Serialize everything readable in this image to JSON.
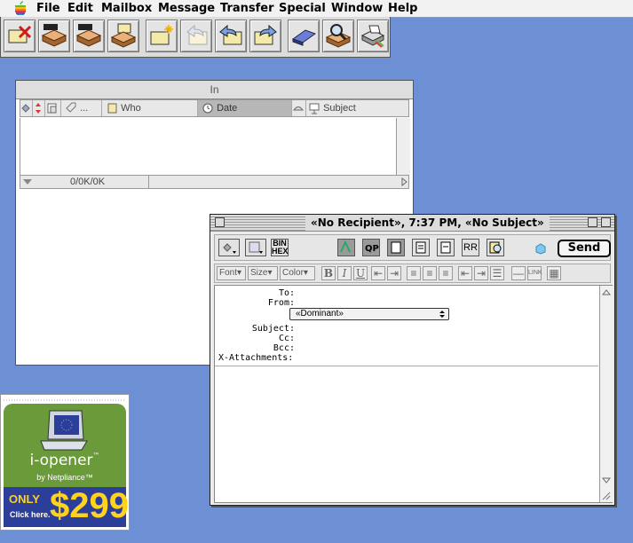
{
  "menubar": {
    "apple_icon": "apple-logo-icon",
    "items": [
      "File",
      "Edit",
      "Mailbox",
      "Message",
      "Transfer",
      "Special",
      "Window",
      "Help"
    ]
  },
  "toolbar": {
    "buttons": [
      "delete-message-icon",
      "out-mailbox-icon",
      "in-mailbox-icon",
      "check-mail-icon",
      "new-message-icon",
      "reply-icon",
      "reply-all-icon",
      "forward-icon",
      "redirect-icon",
      "open-book-icon",
      "find-icon",
      "print-icon"
    ]
  },
  "in_window": {
    "title": "In",
    "columns": {
      "dots": "...",
      "who": "Who",
      "date": "Date",
      "subject": "Subject"
    },
    "status": "0/0K/0K"
  },
  "message_window": {
    "title": "«No Recipient», 7:37 PM, «No Subject»",
    "toolbar": {
      "binhex_label_1": "BIN",
      "binhex_label_2": "HEX",
      "rr_label": "RR",
      "send_label": "Send"
    },
    "format": {
      "font_label": "Font",
      "size_label": "Size",
      "color_label": "Color",
      "bold_label": "B",
      "italic_label": "I",
      "underline_label": "U",
      "link_label": "LINK"
    },
    "headers": {
      "to": "To:",
      "from": "From:",
      "personality": "«Dominant»",
      "subject": "Subject:",
      "cc": "Cc:",
      "bcc": "Bcc:",
      "attachments": "X-Attachments:"
    }
  },
  "ad": {
    "brand": "i-opener",
    "tm": "™",
    "by": "by Netpliance™",
    "only": "ONLY",
    "click": "Click here.",
    "price": "$299"
  },
  "colors": {
    "desktop": "#6d8fd4",
    "ad_green": "#6a9a3a",
    "ad_blue": "#2b3f9a",
    "ad_price": "#ffd21e"
  }
}
